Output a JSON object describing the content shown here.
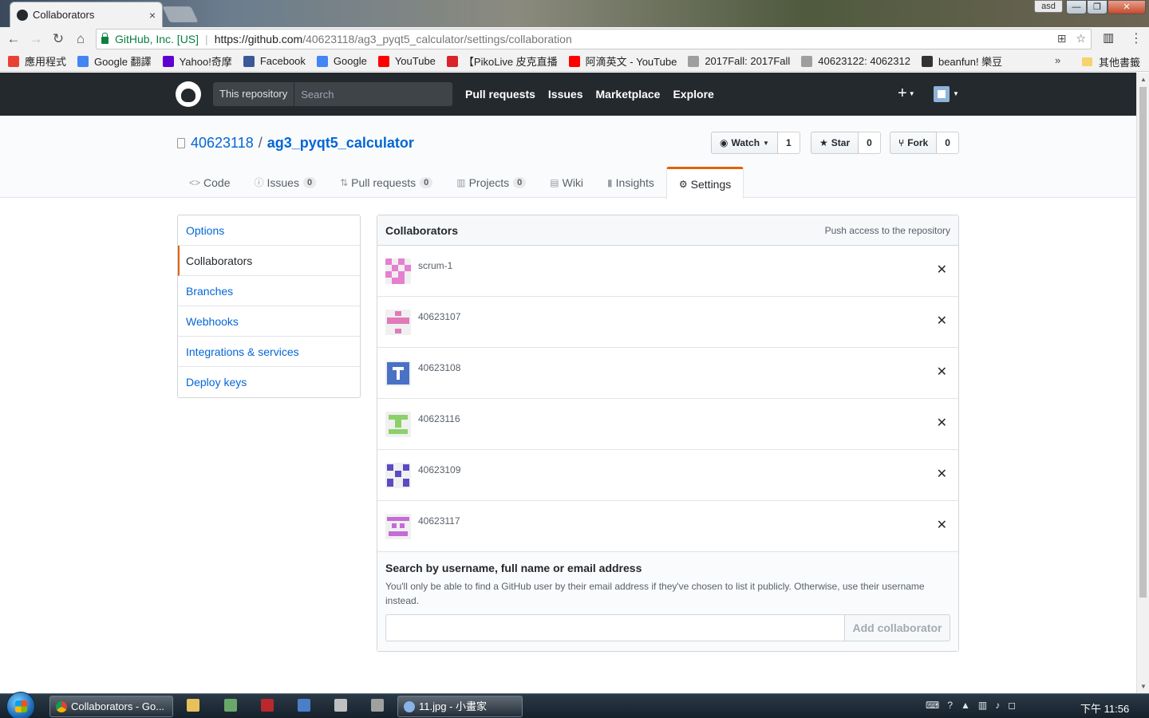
{
  "browser": {
    "tab_title": "Collaborators",
    "tab_close": "×",
    "user_badge": "asd",
    "window_buttons": {
      "minimize": "—",
      "maximize": "❐",
      "close": "✕"
    },
    "address": {
      "secure_label": "GitHub, Inc. [US]",
      "url_host": "https://github.com",
      "url_path": "/40623118/ag3_pyqt5_calculator/settings/collaboration"
    },
    "bookmarks": [
      {
        "label": "應用程式",
        "icon": "apps-grid-icon",
        "color": "#e94235"
      },
      {
        "label": "Google 翻譯",
        "icon": "google-translate-icon",
        "color": "#4285f4"
      },
      {
        "label": "Yahoo!奇摩",
        "icon": "yahoo-icon",
        "color": "#5f01d1"
      },
      {
        "label": "Facebook",
        "icon": "facebook-icon",
        "color": "#3b5998"
      },
      {
        "label": "Google",
        "icon": "google-icon",
        "color": "#4285f4"
      },
      {
        "label": "YouTube",
        "icon": "youtube-icon",
        "color": "#ff0000"
      },
      {
        "label": "【PikoLive 皮克直播",
        "icon": "pikolive-icon",
        "color": "#d9242b"
      },
      {
        "label": "阿滴英文 - YouTube",
        "icon": "youtube-icon",
        "color": "#ff0000"
      },
      {
        "label": "2017Fall: 2017Fall",
        "icon": "page-icon",
        "color": "#9e9e9e"
      },
      {
        "label": "40623122: 4062312",
        "icon": "page-icon",
        "color": "#9e9e9e"
      },
      {
        "label": "beanfun! 樂豆",
        "icon": "beanfun-icon",
        "color": "#333333"
      }
    ],
    "bookmarks_more": "»",
    "bookmarks_other": "其他書籤"
  },
  "github": {
    "search_scope": "This repository",
    "search_placeholder": "Search",
    "nav": [
      "Pull requests",
      "Issues",
      "Marketplace",
      "Explore"
    ],
    "plus": "+",
    "repo_owner": "40623118",
    "repo_slash": "/",
    "repo_name": "ag3_pyqt5_calculator",
    "watch": {
      "label": "Watch",
      "count": "1"
    },
    "star": {
      "label": "Star",
      "count": "0"
    },
    "fork": {
      "label": "Fork",
      "count": "0"
    },
    "tabs": [
      {
        "label": "Code",
        "icon": "code-icon",
        "glyph": "<>"
      },
      {
        "label": "Issues",
        "icon": "issue-icon",
        "glyph": "ⓘ",
        "count": "0"
      },
      {
        "label": "Pull requests",
        "icon": "pull-request-icon",
        "glyph": "⇅",
        "count": "0"
      },
      {
        "label": "Projects",
        "icon": "project-icon",
        "glyph": "▥",
        "count": "0"
      },
      {
        "label": "Wiki",
        "icon": "book-icon",
        "glyph": "▤"
      },
      {
        "label": "Insights",
        "icon": "graph-icon",
        "glyph": "▮"
      },
      {
        "label": "Settings",
        "icon": "gear-icon",
        "glyph": "⚙",
        "selected": true
      }
    ],
    "menu": [
      "Options",
      "Collaborators",
      "Branches",
      "Webhooks",
      "Integrations & services",
      "Deploy keys"
    ],
    "menu_selected": "Collaborators",
    "collaborators": {
      "title": "Collaborators",
      "note": "Push access to the repository",
      "users": [
        {
          "name": "scrum-1",
          "avatar_color": "#e57fd0"
        },
        {
          "name": "40623107",
          "avatar_color": "#e07ab8"
        },
        {
          "name": "40623108",
          "avatar_color": "#4a72c4"
        },
        {
          "name": "40623116",
          "avatar_color": "#8cd06a"
        },
        {
          "name": "40623109",
          "avatar_color": "#5a4bc2"
        },
        {
          "name": "40623117",
          "avatar_color": "#c56ad8"
        }
      ],
      "remove_glyph": "✕",
      "search_label": "Search by username, full name or email address",
      "search_help": "You'll only be able to find a GitHub user by their email address if they've chosen to list it publicly. Otherwise, use their username instead.",
      "add_button": "Add collaborator"
    }
  },
  "taskbar": {
    "tasks": [
      {
        "label": "Collaborators - Go...",
        "icon": "chrome-icon"
      },
      {
        "label": "11.jpg - 小畫家",
        "icon": "paint-icon"
      }
    ],
    "clock": "下午 11:56"
  }
}
